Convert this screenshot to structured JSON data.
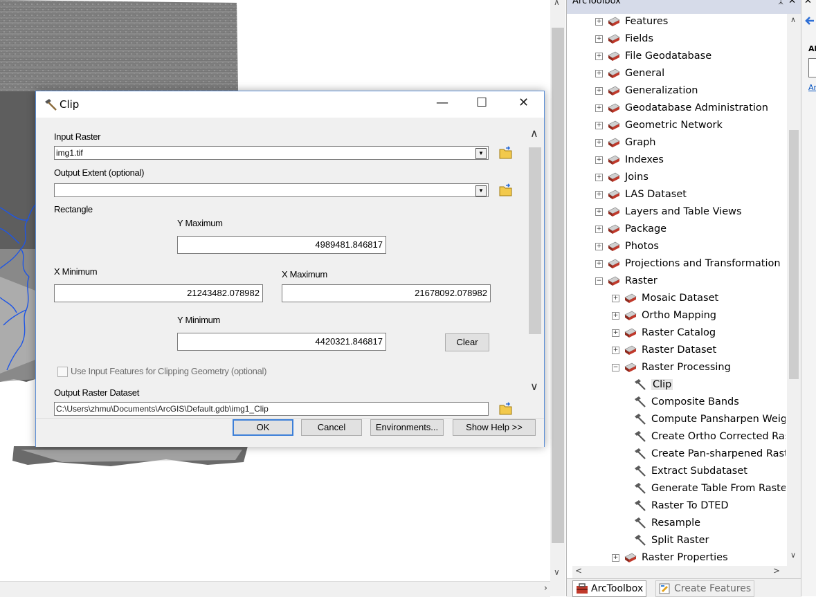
{
  "arctoolbox": {
    "title": "ArcToolbox",
    "pin_icon": "pin-icon",
    "close_icon": "close-icon",
    "tree": [
      {
        "label": "Features",
        "level": 0,
        "expander": "+",
        "icon": "toolbox-icon"
      },
      {
        "label": "Fields",
        "level": 0,
        "expander": "+",
        "icon": "toolbox-icon"
      },
      {
        "label": "File Geodatabase",
        "level": 0,
        "expander": "+",
        "icon": "toolbox-icon"
      },
      {
        "label": "General",
        "level": 0,
        "expander": "+",
        "icon": "toolbox-icon"
      },
      {
        "label": "Generalization",
        "level": 0,
        "expander": "+",
        "icon": "toolbox-icon"
      },
      {
        "label": "Geodatabase Administration",
        "level": 0,
        "expander": "+",
        "icon": "toolbox-icon"
      },
      {
        "label": "Geometric Network",
        "level": 0,
        "expander": "+",
        "icon": "toolbox-icon"
      },
      {
        "label": "Graph",
        "level": 0,
        "expander": "+",
        "icon": "toolbox-icon"
      },
      {
        "label": "Indexes",
        "level": 0,
        "expander": "+",
        "icon": "toolbox-icon"
      },
      {
        "label": "Joins",
        "level": 0,
        "expander": "+",
        "icon": "toolbox-icon"
      },
      {
        "label": "LAS Dataset",
        "level": 0,
        "expander": "+",
        "icon": "toolbox-icon"
      },
      {
        "label": "Layers and Table Views",
        "level": 0,
        "expander": "+",
        "icon": "toolbox-icon"
      },
      {
        "label": "Package",
        "level": 0,
        "expander": "+",
        "icon": "toolbox-icon"
      },
      {
        "label": "Photos",
        "level": 0,
        "expander": "+",
        "icon": "toolbox-icon"
      },
      {
        "label": "Projections and Transformation",
        "level": 0,
        "expander": "+",
        "icon": "toolbox-icon"
      },
      {
        "label": "Raster",
        "level": 0,
        "expander": "−",
        "icon": "toolbox-icon"
      },
      {
        "label": "Mosaic Dataset",
        "level": 1,
        "expander": "+",
        "icon": "toolbox-icon"
      },
      {
        "label": "Ortho Mapping",
        "level": 1,
        "expander": "+",
        "icon": "toolbox-icon"
      },
      {
        "label": "Raster Catalog",
        "level": 1,
        "expander": "+",
        "icon": "toolbox-icon"
      },
      {
        "label": "Raster Dataset",
        "level": 1,
        "expander": "+",
        "icon": "toolbox-icon"
      },
      {
        "label": "Raster Processing",
        "level": 1,
        "expander": "−",
        "icon": "toolbox-icon"
      },
      {
        "label": "Clip",
        "level": 2,
        "expander": "",
        "icon": "hammer-icon",
        "selected": true
      },
      {
        "label": "Composite Bands",
        "level": 2,
        "expander": "",
        "icon": "hammer-icon"
      },
      {
        "label": "Compute Pansharpen Weights",
        "level": 2,
        "expander": "",
        "icon": "hammer-icon"
      },
      {
        "label": "Create Ortho Corrected Raster Dataset",
        "level": 2,
        "expander": "",
        "icon": "hammer-icon"
      },
      {
        "label": "Create Pan-sharpened Raster Dataset",
        "level": 2,
        "expander": "",
        "icon": "hammer-icon"
      },
      {
        "label": "Extract Subdataset",
        "level": 2,
        "expander": "",
        "icon": "hammer-icon"
      },
      {
        "label": "Generate Table From Raster Function",
        "level": 2,
        "expander": "",
        "icon": "hammer-icon"
      },
      {
        "label": "Raster To DTED",
        "level": 2,
        "expander": "",
        "icon": "hammer-icon"
      },
      {
        "label": "Resample",
        "level": 2,
        "expander": "",
        "icon": "hammer-icon"
      },
      {
        "label": "Split Raster",
        "level": 2,
        "expander": "",
        "icon": "hammer-icon"
      },
      {
        "label": "Raster Properties",
        "level": 1,
        "expander": "+",
        "icon": "toolbox-icon"
      }
    ],
    "tabs": [
      {
        "label": "ArcToolbox",
        "active": true
      },
      {
        "label": "Create Features",
        "active": false
      }
    ]
  },
  "right_strip": {
    "heading": "Al",
    "link": "Ar"
  },
  "dialog": {
    "title": "Clip",
    "controls": {
      "minimize": "—",
      "maximize": "☐",
      "close": "✕"
    },
    "input_raster": {
      "label": "Input Raster",
      "value": "img1.tif"
    },
    "output_extent": {
      "label": "Output Extent (optional)",
      "value": ""
    },
    "rectangle_label": "Rectangle",
    "y_maximum": {
      "label": "Y Maximum",
      "value": "4989481.846817"
    },
    "x_minimum": {
      "label": "X Minimum",
      "value": "21243482.078982"
    },
    "x_maximum": {
      "label": "X Maximum",
      "value": "21678092.078982"
    },
    "y_minimum": {
      "label": "Y Minimum",
      "value": "4420321.846817"
    },
    "clear_label": "Clear",
    "use_input_features": {
      "label": "Use Input Features for Clipping Geometry (optional)",
      "checked": false
    },
    "output_raster": {
      "label": "Output Raster Dataset",
      "value": "C:\\Users\\zhmu\\Documents\\ArcGIS\\Default.gdb\\img1_Clip"
    },
    "buttons": {
      "ok": "OK",
      "cancel": "Cancel",
      "environments": "Environments...",
      "help": "Show Help >>"
    }
  },
  "colors": {
    "dialog_border": "#5b8ed6",
    "panel_title": "#d6dbe9",
    "river": "#1e56e6",
    "toolbox_red": "#c0392b",
    "link": "#0050c0"
  }
}
